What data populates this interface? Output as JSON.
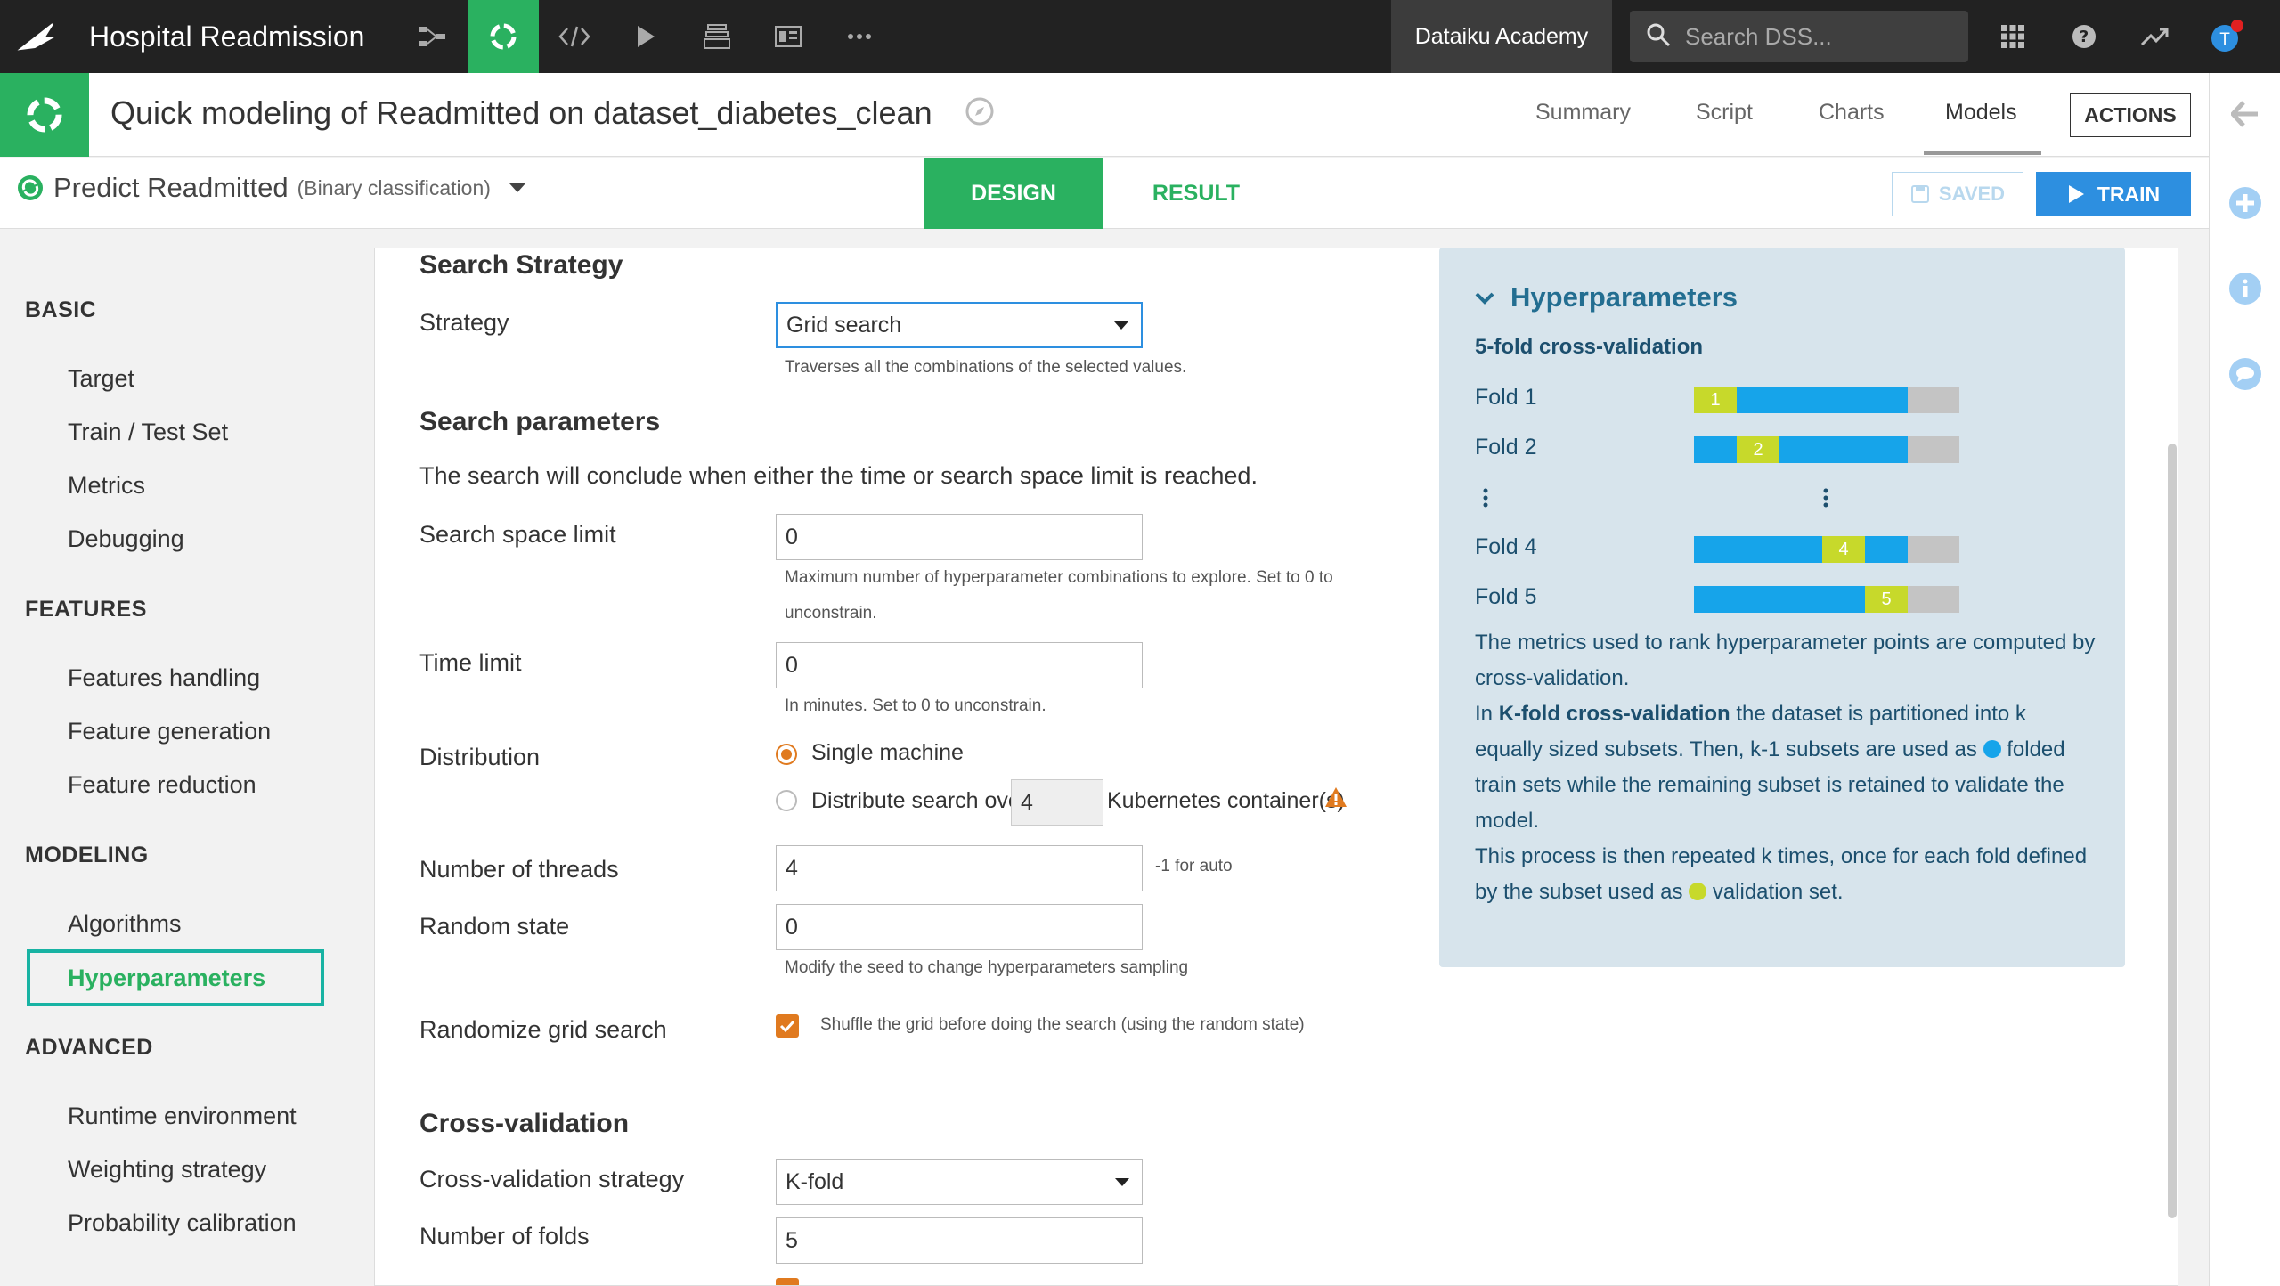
{
  "topbar": {
    "project_name": "Hospital Readmission",
    "academy_label": "Dataiku Academy",
    "search_placeholder": "Search DSS...",
    "avatar_initial": "T"
  },
  "header": {
    "title": "Quick modeling of Readmitted on dataset_diabetes_clean",
    "tabs": [
      "Summary",
      "Script",
      "Charts",
      "Models"
    ],
    "active_tab": "Models",
    "actions_label": "ACTIONS"
  },
  "subheader": {
    "task_title": "Predict Readmitted",
    "task_type": "(Binary classification)",
    "design_tab": "DESIGN",
    "result_tab": "RESULT",
    "saved_label": "SAVED",
    "train_label": "TRAIN"
  },
  "sidebar": {
    "sections": [
      {
        "title": "BASIC",
        "items": [
          "Target",
          "Train / Test Set",
          "Metrics",
          "Debugging"
        ]
      },
      {
        "title": "FEATURES",
        "items": [
          "Features handling",
          "Feature generation",
          "Feature reduction"
        ]
      },
      {
        "title": "MODELING",
        "items": [
          "Algorithms",
          "Hyperparameters"
        ]
      },
      {
        "title": "ADVANCED",
        "items": [
          "Runtime environment",
          "Weighting strategy",
          "Probability calibration"
        ]
      }
    ],
    "active_item": "Hyperparameters"
  },
  "form": {
    "search_strategy_heading": "Search Strategy",
    "strategy_label": "Strategy",
    "strategy_value": "Grid search",
    "strategy_help": "Traverses all the combinations of the selected values.",
    "search_params_heading": "Search parameters",
    "search_params_desc": "The search will conclude when either the time or search space limit is reached.",
    "search_space_label": "Search space limit",
    "search_space_value": "0",
    "search_space_help_1": "Maximum number of hyperparameter combinations to explore. Set to 0 to",
    "search_space_help_2": "unconstrain.",
    "time_limit_label": "Time limit",
    "time_limit_value": "0",
    "time_limit_help": "In minutes. Set to 0 to unconstrain.",
    "distribution_label": "Distribution",
    "single_machine_label": "Single machine",
    "distribute_label": "Distribute search over",
    "containers_value": "4",
    "containers_label": "Kubernetes container(s)",
    "threads_label": "Number of threads",
    "threads_value": "4",
    "threads_help": "-1 for auto",
    "random_state_label": "Random state",
    "random_state_value": "0",
    "random_state_help": "Modify the seed to change hyperparameters sampling",
    "randomize_label": "Randomize grid search",
    "randomize_help": "Shuffle the grid before doing the search (using the random state)",
    "cv_heading": "Cross-validation",
    "cv_strategy_label": "Cross-validation strategy",
    "cv_strategy_value": "K-fold",
    "folds_label": "Number of folds",
    "folds_value": "5"
  },
  "info": {
    "title": "Hyperparameters",
    "subtitle": "5-fold cross-validation",
    "folds": [
      {
        "label": "Fold 1",
        "index": "1",
        "val_position": 0
      },
      {
        "label": "Fold 2",
        "index": "2",
        "val_position": 1
      },
      {
        "label": "Fold 4",
        "index": "4",
        "val_position": 3
      },
      {
        "label": "Fold 5",
        "index": "5",
        "val_position": 4
      }
    ],
    "text_1": "The metrics used to rank hyperparameter points are computed by cross-validation.",
    "text_2a": "In ",
    "text_2b": "K-fold cross-validation",
    "text_2c": " the dataset is partitioned into k equally sized subsets. Then, k-1 subsets are used as ",
    "text_2d": " folded train sets while the remaining subset is retained to validate the model.",
    "text_3a": "This process is then repeated k times, once for each fold defined by the subset used as ",
    "text_3b": " validation set."
  },
  "colors": {
    "accent_green": "#2ab160",
    "train_blue": "#16a4ea",
    "validation_yellow": "#c7d92b",
    "test_grey": "#c4c4c4",
    "checkbox_orange": "#e07a1f"
  }
}
